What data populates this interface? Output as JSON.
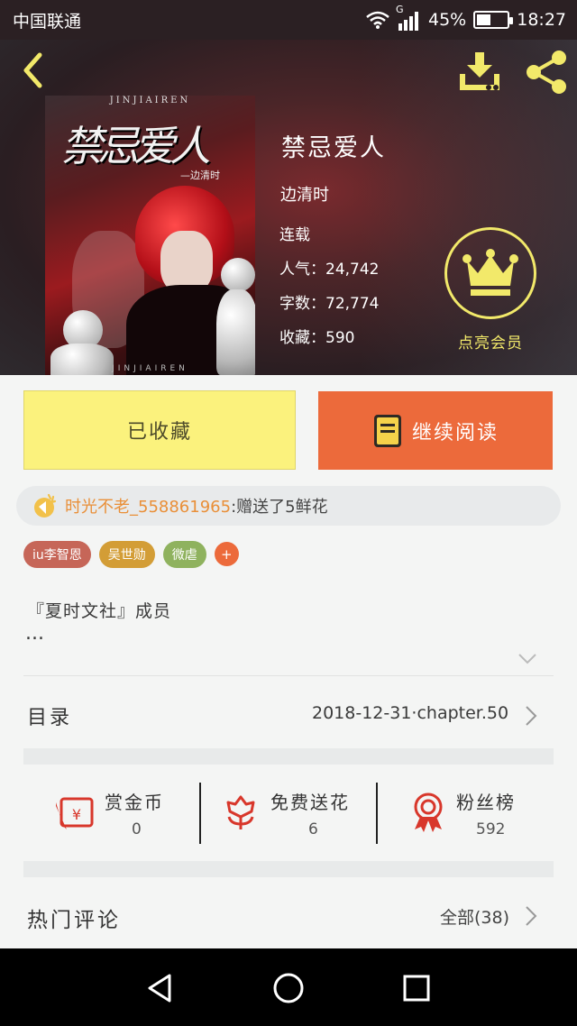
{
  "status_bar": {
    "carrier": "中国联通",
    "network": "G",
    "battery": "45%",
    "battery_level": 0.45,
    "time": "18:27"
  },
  "book": {
    "title": "禁忌爱人",
    "author": "边清时",
    "status": "连载",
    "popularity": "人气：24,742",
    "word_count": "字数：72,774",
    "favorites": "收藏：590",
    "cover": {
      "top_text": "JINJIAIREN",
      "title": "禁忌爱人",
      "subtitle": "—边清时",
      "bottom_text": "JINJIAIREN"
    }
  },
  "vip": {
    "label": "点亮会员"
  },
  "actions": {
    "collected_label": "已收藏",
    "continue_label": "继续阅读"
  },
  "gift": {
    "user": "时光不老_558861965",
    "message": ":赠送了5鲜花"
  },
  "tags": [
    {
      "label": "iu李智恩",
      "color": "#c66658"
    },
    {
      "label": "吴世勋",
      "color": "#d39d36"
    },
    {
      "label": "微虐",
      "color": "#8fb25e"
    }
  ],
  "tag_add_label": "+",
  "description": {
    "line1": "『夏时文社』成员",
    "line2": "..."
  },
  "toc": {
    "label": "目录",
    "latest": "2018-12-31·chapter.50"
  },
  "stats": [
    {
      "label": "赏金币",
      "value": "0",
      "icon": "red-envelope-icon"
    },
    {
      "label": "免费送花",
      "value": "6",
      "icon": "flower-icon"
    },
    {
      "label": "粉丝榜",
      "value": "592",
      "icon": "award-ribbon-icon"
    }
  ],
  "comments": {
    "label": "热门评论",
    "all": "全部(38)"
  },
  "colors": {
    "accent_orange": "#ec6a3b",
    "collect_yellow": "#fbf27d",
    "vip_yellow": "#f2e96a",
    "stat_red": "#d8372b"
  }
}
